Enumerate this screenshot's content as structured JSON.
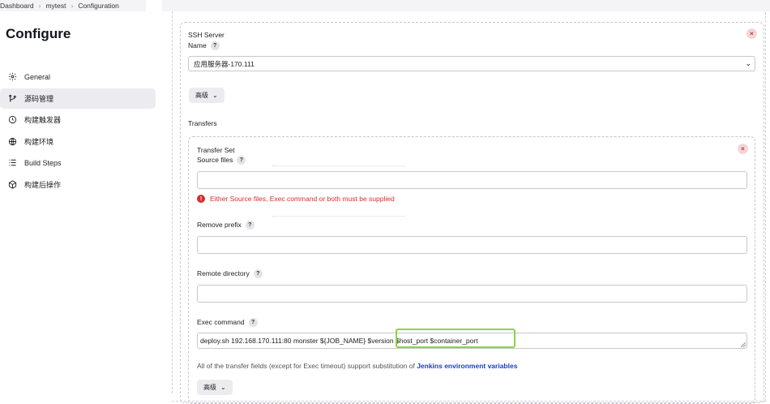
{
  "breadcrumb": [
    "Dashboard",
    "mytest",
    "Configuration"
  ],
  "page_title": "Configure",
  "nav": [
    {
      "label": "General",
      "icon": "gear-icon",
      "active": false
    },
    {
      "label": "源码管理",
      "icon": "branch-icon",
      "active": true
    },
    {
      "label": "构建触发器",
      "icon": "clock-icon",
      "active": false
    },
    {
      "label": "构建环境",
      "icon": "globe-icon",
      "active": false
    },
    {
      "label": "Build Steps",
      "icon": "list-icon",
      "active": false
    },
    {
      "label": "构建后操作",
      "icon": "cube-icon",
      "active": false
    }
  ],
  "ssh_server": {
    "label_line1": "SSH Server",
    "label_line2": "Name",
    "help": "?",
    "selected": "应用服务器-170.111",
    "advanced_label": "高级",
    "close": "×"
  },
  "transfers": {
    "heading": "Transfers",
    "set": {
      "label_line1": "Transfer Set",
      "label_line2": "Source files",
      "close": "×",
      "error": "Either Source files, Exec command or both must be supplied",
      "remove_prefix_label": "Remove prefix",
      "remote_directory_label": "Remote directory",
      "exec_command_label": "Exec command",
      "exec_command_value": "deploy.sh 192.168.170.111:80 monster ${JOB_NAME} $version $host_port $container_port",
      "note_prefix": "All of the transfer fields (except for Exec timeout) support substitution of ",
      "note_link": "Jenkins environment variables",
      "advanced_label": "高级"
    }
  },
  "colors": {
    "accent_link": "#1c3fb8",
    "error": "#d32f2f",
    "highlight": "#8ad442"
  }
}
